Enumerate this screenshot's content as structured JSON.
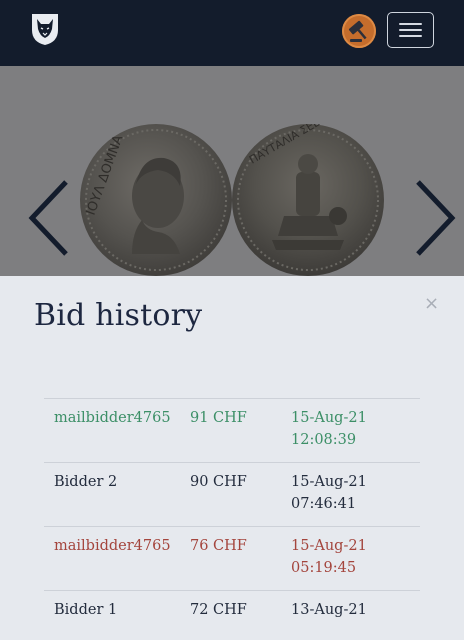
{
  "header": {
    "logo_icon": "panther-head-logo-icon",
    "auction_icon": "gavel-icon",
    "menu_icon": "hamburger-menu-icon"
  },
  "carousel": {
    "prev_icon": "chevron-left-icon",
    "next_icon": "chevron-right-icon",
    "coin_obverse_legend": "ΙΟΥΛ ΔΟΜΝΑ",
    "coin_reverse_legend": "ΠΑΥΤΑΛΙΑ ΣΕΒΗΡΟΥ"
  },
  "modal": {
    "title": "Bid history",
    "close_label": "×",
    "bids": [
      {
        "bidder": "mailbidder4765",
        "amount": "91 CHF",
        "date": "15-Aug-21",
        "time": "12:08:39",
        "status": "green"
      },
      {
        "bidder": "Bidder 2",
        "amount": "90 CHF",
        "date": "15-Aug-21",
        "time": "07:46:41",
        "status": "dark"
      },
      {
        "bidder": "mailbidder4765",
        "amount": "76 CHF",
        "date": "15-Aug-21",
        "time": "05:19:45",
        "status": "red"
      },
      {
        "bidder": "Bidder 1",
        "amount": "72 CHF",
        "date": "13-Aug-21",
        "time": "",
        "status": "dark"
      }
    ]
  },
  "colors": {
    "navbar": "#131c2c",
    "modal_bg": "#e6e9ee",
    "winning_bid": "#3c8f67",
    "outbid": "#a4453d",
    "text": "#232c3d"
  }
}
